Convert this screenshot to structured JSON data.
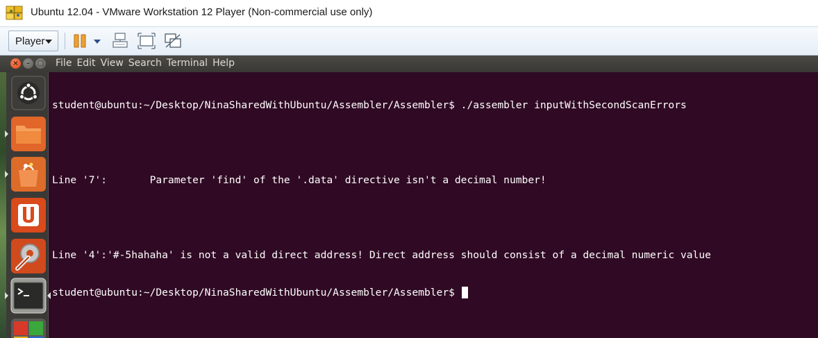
{
  "window": {
    "title": "Ubuntu 12.04 - VMware Workstation 12 Player (Non-commercial use only)"
  },
  "toolbar": {
    "player_label": "Player",
    "icons": [
      "pause-icon",
      "dropdown-caret-icon",
      "send-ctrl-alt-del-icon",
      "fit-guest-icon",
      "unity-mode-icon"
    ],
    "accent": "#f0a030"
  },
  "menubar": {
    "items": [
      "File",
      "Edit",
      "View",
      "Search",
      "Terminal",
      "Help"
    ]
  },
  "launcher": {
    "items": [
      "dash-home-icon",
      "files-icon",
      "software-center-icon",
      "ubuntu-one-icon",
      "system-settings-icon",
      "terminal-icon",
      "workspaces-icon"
    ]
  },
  "terminal": {
    "background": "#300a24",
    "lines": [
      "student@ubuntu:~/Desktop/NinaSharedWithUbuntu/Assembler/Assembler$ ./assembler inputWithSecondScanErrors",
      "",
      "Line '7':       Parameter 'find' of the '.data' directive isn't a decimal number!",
      "",
      "Line '4':'#-5hahaha' is not a valid direct address! Direct address should consist of a decimal numeric value",
      "student@ubuntu:~/Desktop/NinaSharedWithUbuntu/Assembler/Assembler$ "
    ]
  }
}
